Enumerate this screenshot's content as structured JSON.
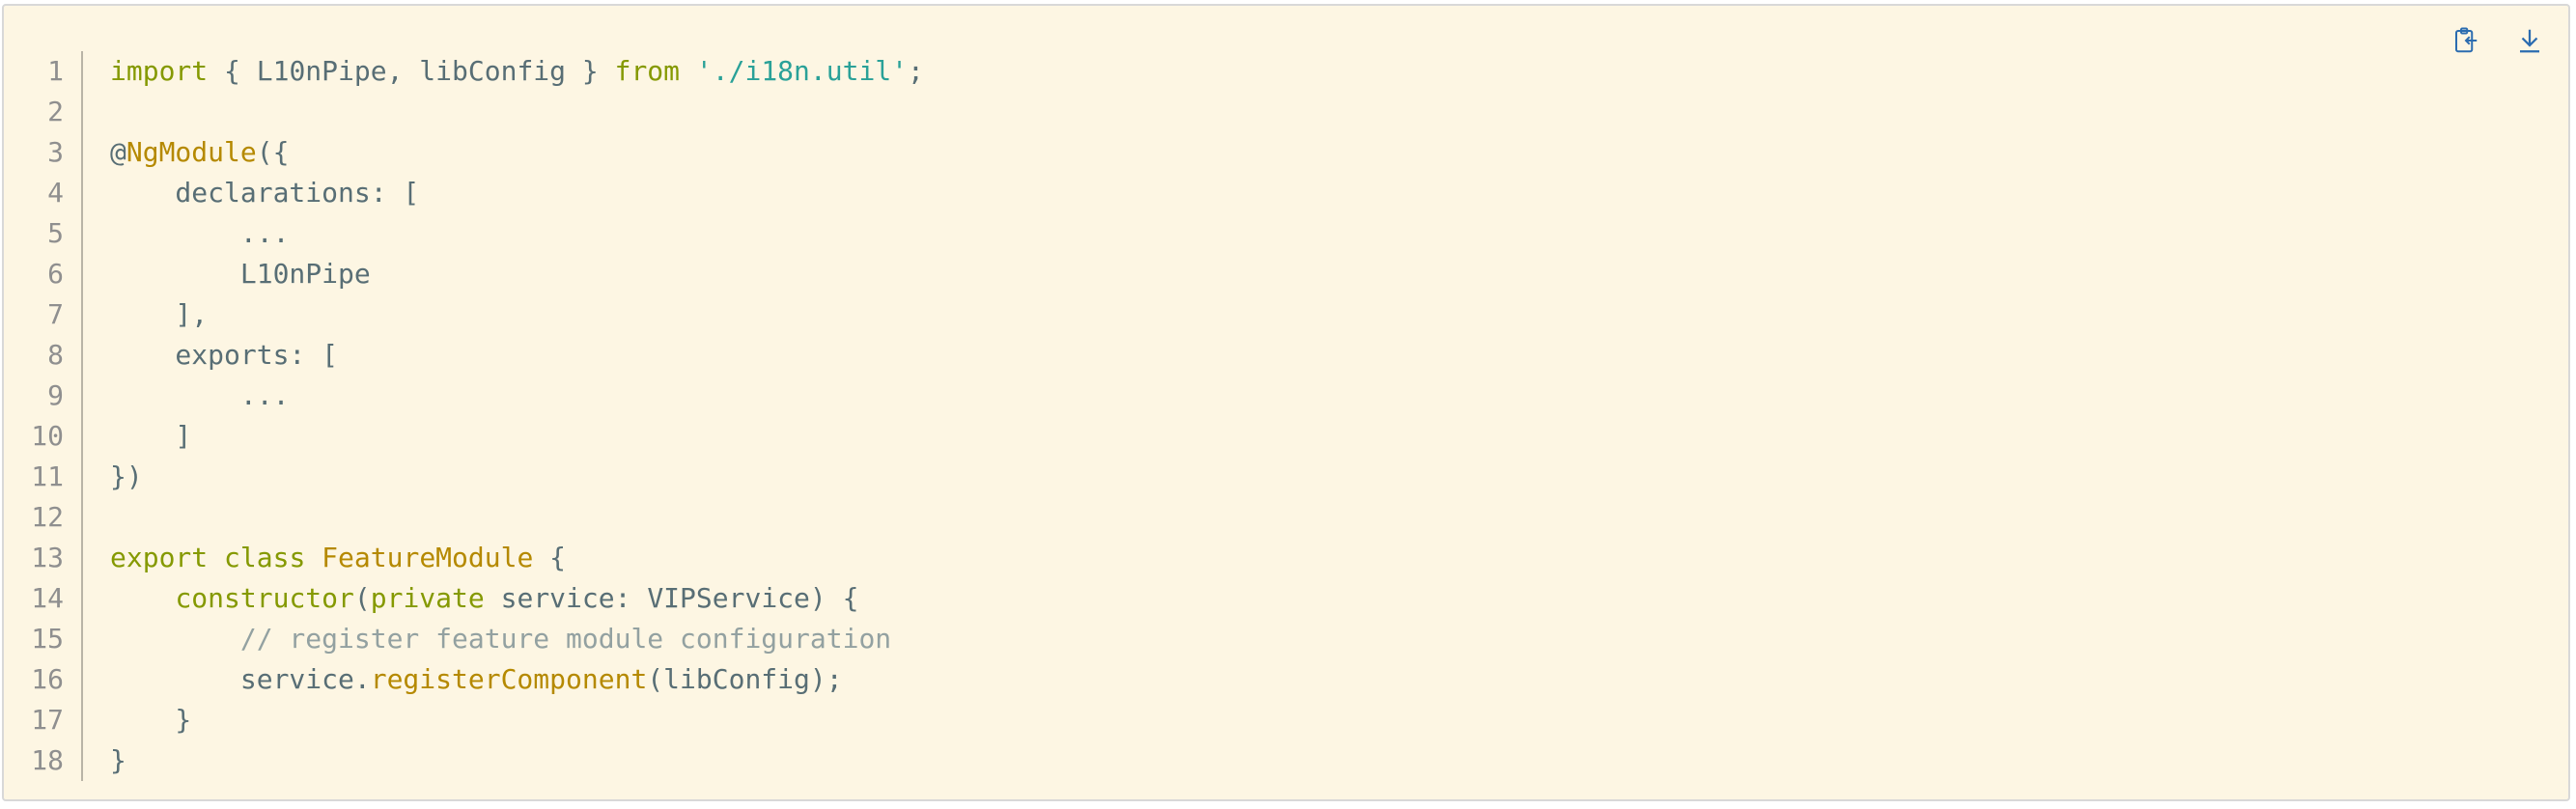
{
  "toolbar": {
    "copy_icon": "clipboard-copy-icon",
    "download_icon": "download-icon",
    "accent": "#2b6cb0"
  },
  "colors": {
    "background": "#fdf6e3",
    "keyword": "#859900",
    "string": "#2aa198",
    "function": "#b58900",
    "comment": "#93a1a1",
    "text": "#586e75",
    "line_number": "#8f8f8f"
  },
  "code": {
    "line_numbers": [
      "1",
      "2",
      "3",
      "4",
      "5",
      "6",
      "7",
      "8",
      "9",
      "10",
      "11",
      "12",
      "13",
      "14",
      "15",
      "16",
      "17",
      "18"
    ],
    "lines": [
      [
        {
          "t": "kw",
          "v": "import"
        },
        {
          "t": "tx",
          "v": " { L10nPipe, libConfig } "
        },
        {
          "t": "kw",
          "v": "from"
        },
        {
          "t": "tx",
          "v": " "
        },
        {
          "t": "str",
          "v": "'./i18n.util'"
        },
        {
          "t": "tx",
          "v": ";"
        }
      ],
      [],
      [
        {
          "t": "tx",
          "v": "@"
        },
        {
          "t": "dec",
          "v": "NgModule"
        },
        {
          "t": "tx",
          "v": "({"
        }
      ],
      [
        {
          "t": "tx",
          "v": "    declarations: ["
        }
      ],
      [
        {
          "t": "tx",
          "v": "        ..."
        }
      ],
      [
        {
          "t": "tx",
          "v": "        L10nPipe"
        }
      ],
      [
        {
          "t": "tx",
          "v": "    ],"
        }
      ],
      [
        {
          "t": "tx",
          "v": "    exports: ["
        }
      ],
      [
        {
          "t": "tx",
          "v": "        ..."
        }
      ],
      [
        {
          "t": "tx",
          "v": "    ]"
        }
      ],
      [
        {
          "t": "tx",
          "v": "})"
        }
      ],
      [],
      [
        {
          "t": "kw",
          "v": "export"
        },
        {
          "t": "tx",
          "v": " "
        },
        {
          "t": "kw",
          "v": "class"
        },
        {
          "t": "tx",
          "v": " "
        },
        {
          "t": "cls",
          "v": "FeatureModule"
        },
        {
          "t": "tx",
          "v": " {"
        }
      ],
      [
        {
          "t": "tx",
          "v": "    "
        },
        {
          "t": "kw",
          "v": "constructor"
        },
        {
          "t": "tx",
          "v": "("
        },
        {
          "t": "kw",
          "v": "private"
        },
        {
          "t": "tx",
          "v": " service: VIPService) {"
        }
      ],
      [
        {
          "t": "tx",
          "v": "        "
        },
        {
          "t": "cm",
          "v": "// register feature module configuration"
        }
      ],
      [
        {
          "t": "tx",
          "v": "        service."
        },
        {
          "t": "fn",
          "v": "registerComponent"
        },
        {
          "t": "tx",
          "v": "(libConfig);"
        }
      ],
      [
        {
          "t": "tx",
          "v": "    }"
        }
      ],
      [
        {
          "t": "tx",
          "v": "}"
        }
      ]
    ]
  }
}
